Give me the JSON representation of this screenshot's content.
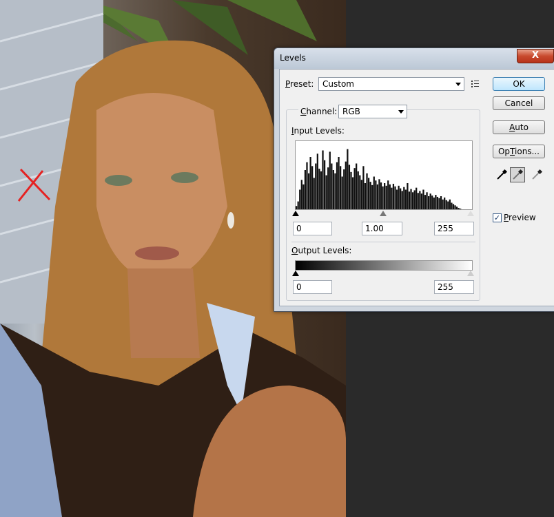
{
  "dialog": {
    "title": "Levels",
    "close_label": "X"
  },
  "preset": {
    "label_accel": "P",
    "label_rest": "reset:",
    "value": "Custom"
  },
  "channel": {
    "label_accel": "C",
    "label_rest": "hannel:",
    "value": "RGB"
  },
  "input_levels": {
    "label_accel": "I",
    "label_rest": "nput Levels:",
    "black": "0",
    "gamma": "1.00",
    "white": "255"
  },
  "output_levels": {
    "label_accel": "O",
    "label_rest": "utput Levels:",
    "black": "0",
    "white": "255"
  },
  "buttons": {
    "ok": "OK",
    "cancel": "Cancel",
    "auto_accel": "A",
    "auto_rest": "uto",
    "options_accel": "T",
    "options_pre": "Op",
    "options_rest": "ions..."
  },
  "preview": {
    "label_accel": "P",
    "label_rest": "review",
    "checked": true,
    "check_glyph": "✓"
  },
  "icons": {
    "preset_menu": "preset-options-icon",
    "eyedropper_black": "eyedropper-black-icon",
    "eyedropper_gray": "eyedropper-gray-icon",
    "eyedropper_white": "eyedropper-white-icon"
  },
  "colors": {
    "annotation_red": "#e52222",
    "titlebar": "#c4cfdc",
    "close_button": "#c84a2e"
  },
  "histogram_levels": [
    5,
    12,
    30,
    45,
    38,
    60,
    72,
    55,
    80,
    66,
    48,
    70,
    85,
    62,
    58,
    90,
    75,
    52,
    64,
    88,
    70,
    60,
    55,
    72,
    80,
    66,
    50,
    61,
    73,
    92,
    68,
    57,
    49,
    63,
    70,
    58,
    52,
    45,
    66,
    40,
    55,
    48,
    42,
    37,
    50,
    44,
    38,
    46,
    41,
    35,
    40,
    36,
    44,
    38,
    33,
    39,
    35,
    30,
    36,
    32,
    28,
    34,
    30,
    40,
    27,
    31,
    26,
    29,
    33,
    25,
    28,
    24,
    30,
    22,
    26,
    20,
    24,
    21,
    18,
    22,
    19,
    17,
    20,
    15,
    18,
    14,
    12,
    15,
    10,
    8,
    6,
    4,
    2,
    1,
    0,
    0,
    0,
    0,
    0,
    0
  ]
}
